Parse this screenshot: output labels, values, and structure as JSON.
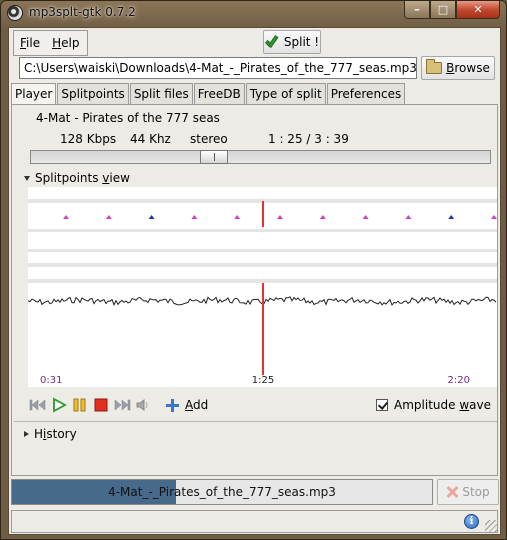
{
  "window": {
    "title": "mp3splt-gtk 0.7.2",
    "min_glyph": "–",
    "max_glyph": "□",
    "close_glyph": "✕"
  },
  "menu": {
    "file": "File",
    "help": "Help"
  },
  "toolbar": {
    "split_label": "Split !"
  },
  "file": {
    "path": "C:\\Users\\waiski\\Downloads\\4-Mat_-_Pirates_of_the_777_seas.mp3",
    "browse_label": "Browse"
  },
  "tabs": [
    "Player",
    "Splitpoints",
    "Split files",
    "FreeDB",
    "Type of split",
    "Preferences"
  ],
  "player": {
    "song_title": "4-Mat - Pirates of the 777 seas",
    "bitrate": "128 Kbps",
    "frequency": "44 Khz",
    "mode": "stereo",
    "position": "1 : 25 / 3 : 39",
    "progress_fraction": 0.39
  },
  "splitpoints_view": {
    "label": "Splitpoints view",
    "time_labels": [
      "0:31",
      "1:25",
      "2:20"
    ],
    "marker_colors": {
      "normal": "#d040c0",
      "selected": "#3030a0",
      "cursor": "#e83030",
      "wave": "#222222"
    },
    "markers": [
      "pink",
      "pink",
      "blue",
      "pink",
      "pink",
      "pink",
      "pink",
      "pink",
      "pink",
      "blue",
      "pink",
      "pink"
    ]
  },
  "controls": {
    "add_label": "Add",
    "amplitude_label": "Amplitude wave",
    "amplitude_checked": true
  },
  "history": {
    "label": "History"
  },
  "status": {
    "filename": "4-Mat_-_Pirates_of_the_777_seas.mp3",
    "progress_fraction": 0.39,
    "stop_label": "Stop"
  }
}
